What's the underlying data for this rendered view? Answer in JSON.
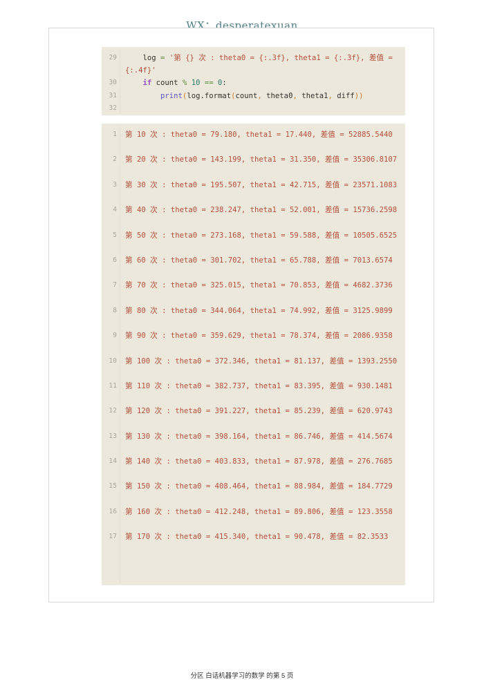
{
  "watermark": "WX：desperatexuan",
  "footer": "分区 白话机器学习的数学 的第 5 页",
  "colors": {
    "block_background": "#EDE8DC",
    "output_text": "#b5503a",
    "line_number": "#a8a49a",
    "watermark": "#4f7f86",
    "page_border": "#d8d8d8",
    "keyword": "#9b4ec2",
    "function": "#5a55c9",
    "punctuation": "#cf7a2e",
    "operator": "#5a8c3e",
    "number": "#2e7d6e",
    "string": "#b5503a"
  },
  "code_block": {
    "line_numbers": [
      "29",
      "30",
      "31",
      "32"
    ],
    "lines": [
      {
        "number": "29",
        "wrapped": true,
        "tokens": [
          {
            "t": "    ",
            "c": "plain"
          },
          {
            "t": "log",
            "c": "plain"
          },
          {
            "t": " ",
            "c": "plain"
          },
          {
            "t": "=",
            "c": "op"
          },
          {
            "t": " ",
            "c": "plain"
          },
          {
            "t": "'第 {} 次 : theta0 = {:.3f}, theta1 = {:.3f}, 差值 = {:.4f}'",
            "c": "str"
          }
        ],
        "plain": "    log = '第 {} 次 : theta0 = {:.3f}, theta1 = {:.3f}, 差值 = {:.4f}'"
      },
      {
        "number": "30",
        "wrapped": false,
        "tokens": [
          {
            "t": "    ",
            "c": "plain"
          },
          {
            "t": "if",
            "c": "kw"
          },
          {
            "t": " count ",
            "c": "plain"
          },
          {
            "t": "%",
            "c": "op"
          },
          {
            "t": " ",
            "c": "plain"
          },
          {
            "t": "10",
            "c": "num"
          },
          {
            "t": " ",
            "c": "plain"
          },
          {
            "t": "==",
            "c": "op"
          },
          {
            "t": " ",
            "c": "plain"
          },
          {
            "t": "0",
            "c": "num"
          },
          {
            "t": ":",
            "c": "plain"
          }
        ],
        "plain": "    if count % 10 == 0:"
      },
      {
        "number": "31",
        "wrapped": false,
        "tokens": [
          {
            "t": "        ",
            "c": "plain"
          },
          {
            "t": "print",
            "c": "fn"
          },
          {
            "t": "(",
            "c": "punc"
          },
          {
            "t": "log",
            "c": "plain"
          },
          {
            "t": ".",
            "c": "plain"
          },
          {
            "t": "format",
            "c": "plain"
          },
          {
            "t": "(",
            "c": "punc"
          },
          {
            "t": "count",
            "c": "plain"
          },
          {
            "t": ",",
            "c": "punc"
          },
          {
            "t": " theta0",
            "c": "plain"
          },
          {
            "t": ",",
            "c": "punc"
          },
          {
            "t": " theta1",
            "c": "plain"
          },
          {
            "t": ",",
            "c": "punc"
          },
          {
            "t": " diff",
            "c": "plain"
          },
          {
            "t": ")",
            "c": "punc"
          },
          {
            "t": ")",
            "c": "punc"
          }
        ],
        "plain": "        print(log.format(count, theta0, theta1, diff))"
      },
      {
        "number": "32",
        "wrapped": false,
        "tokens": [],
        "plain": ""
      }
    ]
  },
  "output_block": {
    "rows": [
      {
        "n": "1",
        "text": "第 10 次 : theta0 = 79.180, theta1 = 17.440, 差值 = 52885.5440",
        "iteration": 10,
        "theta0": 79.18,
        "theta1": 17.44,
        "diff": 52885.544
      },
      {
        "n": "2",
        "text": "第 20 次 : theta0 = 143.199, theta1 = 31.350, 差值 = 35306.8107",
        "iteration": 20,
        "theta0": 143.199,
        "theta1": 31.35,
        "diff": 35306.8107
      },
      {
        "n": "3",
        "text": "第 30 次 : theta0 = 195.507, theta1 = 42.715, 差值 = 23571.1083",
        "iteration": 30,
        "theta0": 195.507,
        "theta1": 42.715,
        "diff": 23571.1083
      },
      {
        "n": "4",
        "text": "第 40 次 : theta0 = 238.247, theta1 = 52.001, 差值 = 15736.2598",
        "iteration": 40,
        "theta0": 238.247,
        "theta1": 52.001,
        "diff": 15736.2598
      },
      {
        "n": "5",
        "text": "第 50 次 : theta0 = 273.168, theta1 = 59.588, 差值 = 10505.6525",
        "iteration": 50,
        "theta0": 273.168,
        "theta1": 59.588,
        "diff": 10505.6525
      },
      {
        "n": "6",
        "text": "第 60 次 : theta0 = 301.702, theta1 = 65.788, 差值 = 7013.6574",
        "iteration": 60,
        "theta0": 301.702,
        "theta1": 65.788,
        "diff": 7013.6574
      },
      {
        "n": "7",
        "text": "第 70 次 : theta0 = 325.015, theta1 = 70.853, 差值 = 4682.3736",
        "iteration": 70,
        "theta0": 325.015,
        "theta1": 70.853,
        "diff": 4682.3736
      },
      {
        "n": "8",
        "text": "第 80 次 : theta0 = 344.064, theta1 = 74.992, 差值 = 3125.9899",
        "iteration": 80,
        "theta0": 344.064,
        "theta1": 74.992,
        "diff": 3125.9899
      },
      {
        "n": "9",
        "text": "第 90 次 : theta0 = 359.629, theta1 = 78.374, 差值 = 2086.9358",
        "iteration": 90,
        "theta0": 359.629,
        "theta1": 78.374,
        "diff": 2086.9358
      },
      {
        "n": "10",
        "text": "第 100 次 : theta0 = 372.346, theta1 = 81.137, 差值 = 1393.2550",
        "iteration": 100,
        "theta0": 372.346,
        "theta1": 81.137,
        "diff": 1393.255
      },
      {
        "n": "11",
        "text": "第 110 次 : theta0 = 382.737, theta1 = 83.395, 差值 = 930.1481",
        "iteration": 110,
        "theta0": 382.737,
        "theta1": 83.395,
        "diff": 930.1481
      },
      {
        "n": "12",
        "text": "第 120 次 : theta0 = 391.227, theta1 = 85.239, 差值 = 620.9743",
        "iteration": 120,
        "theta0": 391.227,
        "theta1": 85.239,
        "diff": 620.9743
      },
      {
        "n": "13",
        "text": "第 130 次 : theta0 = 398.164, theta1 = 86.746, 差值 = 414.5674",
        "iteration": 130,
        "theta0": 398.164,
        "theta1": 86.746,
        "diff": 414.5674
      },
      {
        "n": "14",
        "text": "第 140 次 : theta0 = 403.833, theta1 = 87.978, 差值 = 276.7685",
        "iteration": 140,
        "theta0": 403.833,
        "theta1": 87.978,
        "diff": 276.7685
      },
      {
        "n": "15",
        "text": "第 150 次 : theta0 = 408.464, theta1 = 88.984, 差值 = 184.7729",
        "iteration": 150,
        "theta0": 408.464,
        "theta1": 88.984,
        "diff": 184.7729
      },
      {
        "n": "16",
        "text": "第 160 次 : theta0 = 412.248, theta1 = 89.806, 差值 = 123.3558",
        "iteration": 160,
        "theta0": 412.248,
        "theta1": 89.806,
        "diff": 123.3558
      },
      {
        "n": "17",
        "text": "第 170 次 : theta0 = 415.340, theta1 = 90.478, 差值 = 82.3533",
        "iteration": 170,
        "theta0": 415.34,
        "theta1": 90.478,
        "diff": 82.3533
      }
    ]
  }
}
